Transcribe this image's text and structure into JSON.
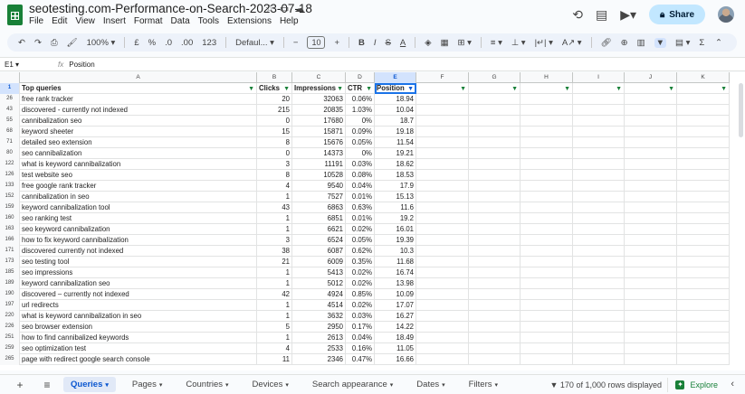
{
  "doc": {
    "title": "seotesting.com-Performance-on-Search-2023-07-18"
  },
  "menu": [
    "File",
    "Edit",
    "View",
    "Insert",
    "Format",
    "Data",
    "Tools",
    "Extensions",
    "Help"
  ],
  "header": {
    "share_label": "Share"
  },
  "toolbar": {
    "zoom": "100%",
    "currency": "£",
    "percent": "%",
    "dec_less": ".0",
    "dec_more": ".00",
    "number_format": "123",
    "font": "Defaul...",
    "minus": "−",
    "font_size": "10",
    "plus": "+",
    "bold": "B",
    "italic": "I",
    "strike": "S",
    "text_color": "A",
    "sigma": "Σ"
  },
  "formula": {
    "cell_ref": "E1",
    "fx": "fx",
    "value": "Position"
  },
  "columns": [
    "A",
    "B",
    "C",
    "D",
    "E",
    "F",
    "G",
    "H",
    "I",
    "J",
    "K"
  ],
  "table": {
    "header_row_number": "1",
    "headers": {
      "query": "Top queries",
      "clicks": "Clicks",
      "impressions": "Impressions",
      "ctr": "CTR",
      "position": "Position"
    },
    "rows": [
      {
        "n": "26",
        "query": "free rank tracker",
        "clicks": "20",
        "impressions": "32063",
        "ctr": "0.06%",
        "position": "18.94"
      },
      {
        "n": "43",
        "query": "discovered - currently not indexed",
        "clicks": "215",
        "impressions": "20835",
        "ctr": "1.03%",
        "position": "10.04"
      },
      {
        "n": "55",
        "query": "cannibalization seo",
        "clicks": "0",
        "impressions": "17680",
        "ctr": "0%",
        "position": "18.7"
      },
      {
        "n": "68",
        "query": "keyword sheeter",
        "clicks": "15",
        "impressions": "15871",
        "ctr": "0.09%",
        "position": "19.18"
      },
      {
        "n": "71",
        "query": "detailed seo extension",
        "clicks": "8",
        "impressions": "15676",
        "ctr": "0.05%",
        "position": "11.54"
      },
      {
        "n": "80",
        "query": "seo cannibalization",
        "clicks": "0",
        "impressions": "14373",
        "ctr": "0%",
        "position": "19.21"
      },
      {
        "n": "122",
        "query": "what is keyword cannibalization",
        "clicks": "3",
        "impressions": "11191",
        "ctr": "0.03%",
        "position": "18.62"
      },
      {
        "n": "126",
        "query": "test website seo",
        "clicks": "8",
        "impressions": "10528",
        "ctr": "0.08%",
        "position": "18.53"
      },
      {
        "n": "133",
        "query": "free google rank tracker",
        "clicks": "4",
        "impressions": "9540",
        "ctr": "0.04%",
        "position": "17.9"
      },
      {
        "n": "152",
        "query": "cannibalization in seo",
        "clicks": "1",
        "impressions": "7527",
        "ctr": "0.01%",
        "position": "15.13"
      },
      {
        "n": "159",
        "query": "keyword cannibalization tool",
        "clicks": "43",
        "impressions": "6863",
        "ctr": "0.63%",
        "position": "11.6"
      },
      {
        "n": "160",
        "query": "seo ranking test",
        "clicks": "1",
        "impressions": "6851",
        "ctr": "0.01%",
        "position": "19.2"
      },
      {
        "n": "163",
        "query": "seo keyword cannibalization",
        "clicks": "1",
        "impressions": "6621",
        "ctr": "0.02%",
        "position": "16.01"
      },
      {
        "n": "166",
        "query": "how to fix keyword cannibalization",
        "clicks": "3",
        "impressions": "6524",
        "ctr": "0.05%",
        "position": "19.39"
      },
      {
        "n": "171",
        "query": "discovered currently not indexed",
        "clicks": "38",
        "impressions": "6087",
        "ctr": "0.62%",
        "position": "10.3"
      },
      {
        "n": "173",
        "query": "seo testing tool",
        "clicks": "21",
        "impressions": "6009",
        "ctr": "0.35%",
        "position": "11.68"
      },
      {
        "n": "185",
        "query": "seo impressions",
        "clicks": "1",
        "impressions": "5413",
        "ctr": "0.02%",
        "position": "16.74"
      },
      {
        "n": "189",
        "query": "keyword cannibalization seo",
        "clicks": "1",
        "impressions": "5012",
        "ctr": "0.02%",
        "position": "13.98"
      },
      {
        "n": "190",
        "query": "discovered – currently not indexed",
        "clicks": "42",
        "impressions": "4924",
        "ctr": "0.85%",
        "position": "10.09"
      },
      {
        "n": "197",
        "query": "url redirects",
        "clicks": "1",
        "impressions": "4514",
        "ctr": "0.02%",
        "position": "17.07"
      },
      {
        "n": "220",
        "query": "what is keyword cannibalization in seo",
        "clicks": "1",
        "impressions": "3632",
        "ctr": "0.03%",
        "position": "16.27"
      },
      {
        "n": "226",
        "query": "seo browser extension",
        "clicks": "5",
        "impressions": "2950",
        "ctr": "0.17%",
        "position": "14.22"
      },
      {
        "n": "251",
        "query": "how to find cannibalized keywords",
        "clicks": "1",
        "impressions": "2613",
        "ctr": "0.04%",
        "position": "18.49"
      },
      {
        "n": "259",
        "query": "seo optimization test",
        "clicks": "4",
        "impressions": "2533",
        "ctr": "0.16%",
        "position": "11.05"
      },
      {
        "n": "265",
        "query": "page with redirect google search console",
        "clicks": "11",
        "impressions": "2346",
        "ctr": "0.47%",
        "position": "16.66"
      }
    ]
  },
  "sheets": [
    {
      "label": "Queries",
      "active": true
    },
    {
      "label": "Pages",
      "active": false
    },
    {
      "label": "Countries",
      "active": false
    },
    {
      "label": "Devices",
      "active": false
    },
    {
      "label": "Search appearance",
      "active": false
    },
    {
      "label": "Dates",
      "active": false
    },
    {
      "label": "Filters",
      "active": false
    }
  ],
  "status": {
    "rows_displayed": "170 of 1,000 rows displayed",
    "explore_label": "Explore"
  },
  "colors": {
    "green": "#188038",
    "accent": "#0b57d0",
    "share_bg": "#c2e7ff"
  }
}
